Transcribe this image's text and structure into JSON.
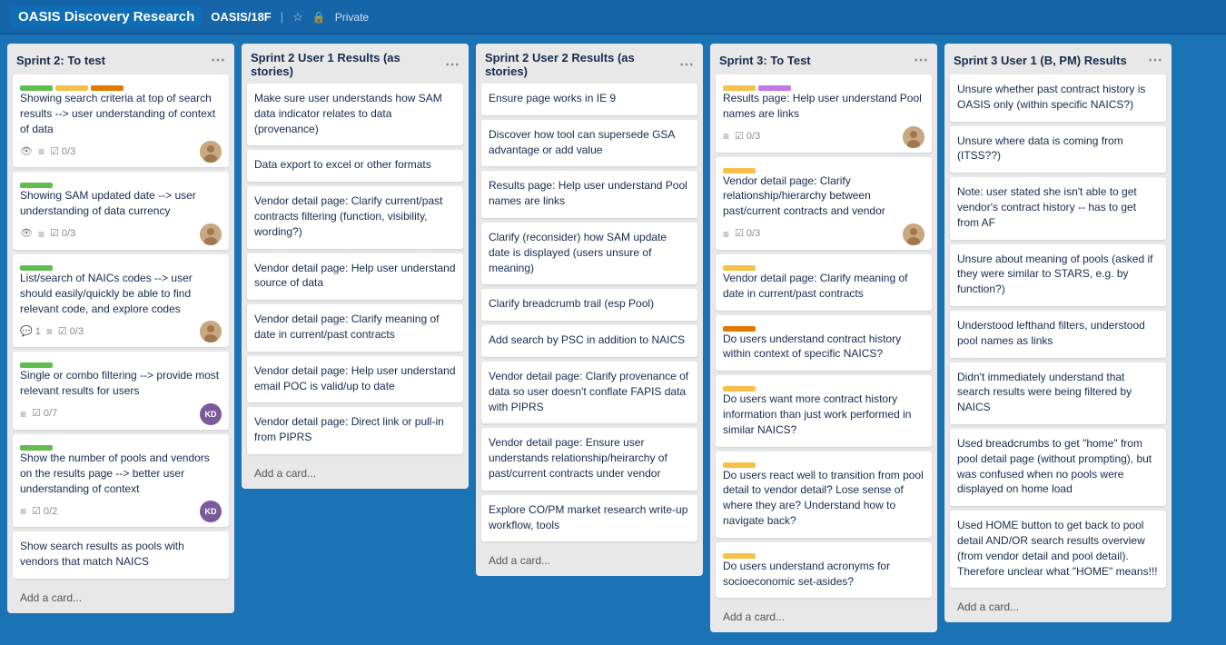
{
  "header": {
    "app_title": "OASIS Discovery Research",
    "board_path": "OASIS/18F",
    "visibility": "Private"
  },
  "lists": [
    {
      "id": "list-sprint2-test",
      "title": "Sprint 2: To test",
      "cards": [
        {
          "id": "c1",
          "text": "Showing search criteria at top of search results --> user understanding of context of data",
          "meta": {
            "eye": true,
            "menu": true,
            "check": "0/3"
          },
          "avatar": "person",
          "labels": [
            {
              "color": "green"
            },
            {
              "color": "yellow"
            },
            {
              "color": "orange"
            }
          ]
        },
        {
          "id": "c2",
          "text": "Showing SAM updated date --> user understanding of data currency",
          "meta": {
            "eye": true,
            "menu": true,
            "check": "0/3"
          },
          "avatar": "person",
          "labels": [
            {
              "color": "green"
            }
          ]
        },
        {
          "id": "c3",
          "text": "List/search of NAICs codes --> user should easily/quickly be able to find relevant code, and explore codes",
          "meta": {
            "comment": "1",
            "menu": true,
            "check": "0/3"
          },
          "avatar": "person",
          "labels": [
            {
              "color": "green"
            }
          ]
        },
        {
          "id": "c4",
          "text": "Single or combo filtering --> provide most relevant results for users",
          "meta": {
            "menu": true,
            "check": "0/7"
          },
          "avatar": "KD",
          "labels": [
            {
              "color": "green"
            }
          ]
        },
        {
          "id": "c5",
          "text": "Show the number of pools and vendors on the results page --> better user understanding of context",
          "meta": {
            "menu": true,
            "check": "0/2"
          },
          "avatar": "KD",
          "labels": [
            {
              "color": "green"
            }
          ]
        },
        {
          "id": "c6",
          "text": "Show search results as pools with vendors that match NAICS",
          "meta": {},
          "avatar": null,
          "labels": []
        }
      ],
      "add_label": "Add a card..."
    },
    {
      "id": "list-sprint2-user1",
      "title": "Sprint 2 User 1 Results (as stories)",
      "cards": [
        {
          "id": "c7",
          "text": "Make sure user understands how SAM data indicator relates to data (provenance)",
          "meta": {},
          "avatar": null,
          "labels": []
        },
        {
          "id": "c8",
          "text": "Data export to excel or other formats",
          "meta": {},
          "avatar": null,
          "labels": []
        },
        {
          "id": "c9",
          "text": "Vendor detail page: Clarify current/past contracts filtering (function, visibility, wording?)",
          "meta": {},
          "avatar": null,
          "labels": []
        },
        {
          "id": "c10",
          "text": "Vendor detail page: Help user understand source of data",
          "meta": {},
          "avatar": null,
          "labels": []
        },
        {
          "id": "c11",
          "text": "Vendor detail page: Clarify meaning of date in current/past contracts",
          "meta": {},
          "avatar": null,
          "labels": []
        },
        {
          "id": "c12",
          "text": "Vendor detail page: Help user understand email POC is valid/up to date",
          "meta": {},
          "avatar": null,
          "labels": []
        },
        {
          "id": "c13",
          "text": "Vendor detail page: Direct link or pull-in from PIPRS",
          "meta": {},
          "avatar": null,
          "labels": []
        }
      ],
      "add_label": "Add a card..."
    },
    {
      "id": "list-sprint2-user2",
      "title": "Sprint 2 User 2 Results (as stories)",
      "cards": [
        {
          "id": "c14",
          "text": "Ensure page works in IE 9",
          "meta": {},
          "avatar": null,
          "labels": []
        },
        {
          "id": "c15",
          "text": "Discover how tool can supersede GSA advantage or add value",
          "meta": {},
          "avatar": null,
          "labels": []
        },
        {
          "id": "c16",
          "text": "Results page: Help user understand Pool names are links",
          "meta": {},
          "avatar": null,
          "labels": []
        },
        {
          "id": "c17",
          "text": "Clarify (reconsider) how SAM update date is displayed (users unsure of meaning)",
          "meta": {},
          "avatar": null,
          "labels": []
        },
        {
          "id": "c18",
          "text": "Clarify breadcrumb trail (esp Pool)",
          "meta": {},
          "avatar": null,
          "labels": []
        },
        {
          "id": "c19",
          "text": "Add search by PSC in addition to NAICS",
          "meta": {},
          "avatar": null,
          "labels": []
        },
        {
          "id": "c20",
          "text": "Vendor detail page: Clarify provenance of data so user doesn't conflate FAPIS data with PIPRS",
          "meta": {},
          "avatar": null,
          "labels": []
        },
        {
          "id": "c21",
          "text": "Vendor detail page: Ensure user understands relationship/heirarchy of past/current contracts under vendor",
          "meta": {},
          "avatar": null,
          "labels": []
        },
        {
          "id": "c22",
          "text": "Explore CO/PM market research write-up workflow, tools",
          "meta": {},
          "avatar": null,
          "labels": []
        }
      ],
      "add_label": "Add a card..."
    },
    {
      "id": "list-sprint3-test",
      "title": "Sprint 3: To Test",
      "cards": [
        {
          "id": "c23",
          "text": "Results page: Help user understand Pool names are links",
          "meta": {
            "menu": true,
            "check": "0/3"
          },
          "avatar": "person",
          "labels": [
            {
              "color": "yellow"
            },
            {
              "color": "purple"
            }
          ]
        },
        {
          "id": "c24",
          "text": "Vendor detail page: Clarify relationship/hierarchy between past/current contracts and vendor",
          "meta": {
            "menu": true,
            "check": "0/3"
          },
          "avatar": "person",
          "labels": [
            {
              "color": "yellow"
            }
          ]
        },
        {
          "id": "c25",
          "text": "Vendor detail page: Clarify meaning of date in current/past contracts",
          "meta": {},
          "avatar": null,
          "labels": [
            {
              "color": "yellow"
            }
          ]
        },
        {
          "id": "c26",
          "text": "Do users understand contract history within context of specific NAICS?",
          "meta": {},
          "avatar": null,
          "labels": [
            {
              "color": "orange"
            }
          ]
        },
        {
          "id": "c27",
          "text": "Do users want more contract history information than just work performed in similar NAICS?",
          "meta": {},
          "avatar": null,
          "labels": [
            {
              "color": "yellow"
            }
          ]
        },
        {
          "id": "c28",
          "text": "Do users react well to transition from pool detail to vendor detail? Lose sense of where they are? Understand how to navigate back?",
          "meta": {},
          "avatar": null,
          "labels": [
            {
              "color": "yellow"
            }
          ]
        },
        {
          "id": "c29",
          "text": "Do users understand acronyms for socioeconomic set-asides?",
          "meta": {},
          "avatar": null,
          "labels": [
            {
              "color": "yellow"
            }
          ]
        }
      ],
      "add_label": "Add a card..."
    },
    {
      "id": "list-sprint3-user1",
      "title": "Sprint 3 User 1 (B, PM) Results",
      "cards": [
        {
          "id": "c30",
          "text": "Unsure whether past contract history is OASIS only (within specific NAICS?)",
          "meta": {},
          "avatar": null,
          "labels": []
        },
        {
          "id": "c31",
          "text": "Unsure where data is coming from (ITSS??)",
          "meta": {},
          "avatar": null,
          "labels": []
        },
        {
          "id": "c32",
          "text": "Note: user stated she isn't able to get vendor's contract history -- has to get from AF",
          "meta": {},
          "avatar": null,
          "labels": []
        },
        {
          "id": "c33",
          "text": "Unsure about meaning of pools (asked if they were similar to STARS, e.g. by function?)",
          "meta": {},
          "avatar": null,
          "labels": []
        },
        {
          "id": "c34",
          "text": "Understood lefthand filters, understood pool names as links",
          "meta": {},
          "avatar": null,
          "labels": []
        },
        {
          "id": "c35",
          "text": "Didn't immediately understand that search results were being filtered by NAICS",
          "meta": {},
          "avatar": null,
          "labels": []
        },
        {
          "id": "c36",
          "text": "Used breadcrumbs to get \"home\" from pool detail page (without prompting), but was confused when no pools were displayed on home load",
          "meta": {},
          "avatar": null,
          "labels": []
        },
        {
          "id": "c37",
          "text": "Used HOME button to get back to pool detail AND/OR search results overview (from vendor detail and pool detail). Therefore unclear what \"HOME\" means!!!",
          "meta": {},
          "avatar": null,
          "labels": []
        }
      ],
      "add_label": "Add a card..."
    }
  ]
}
